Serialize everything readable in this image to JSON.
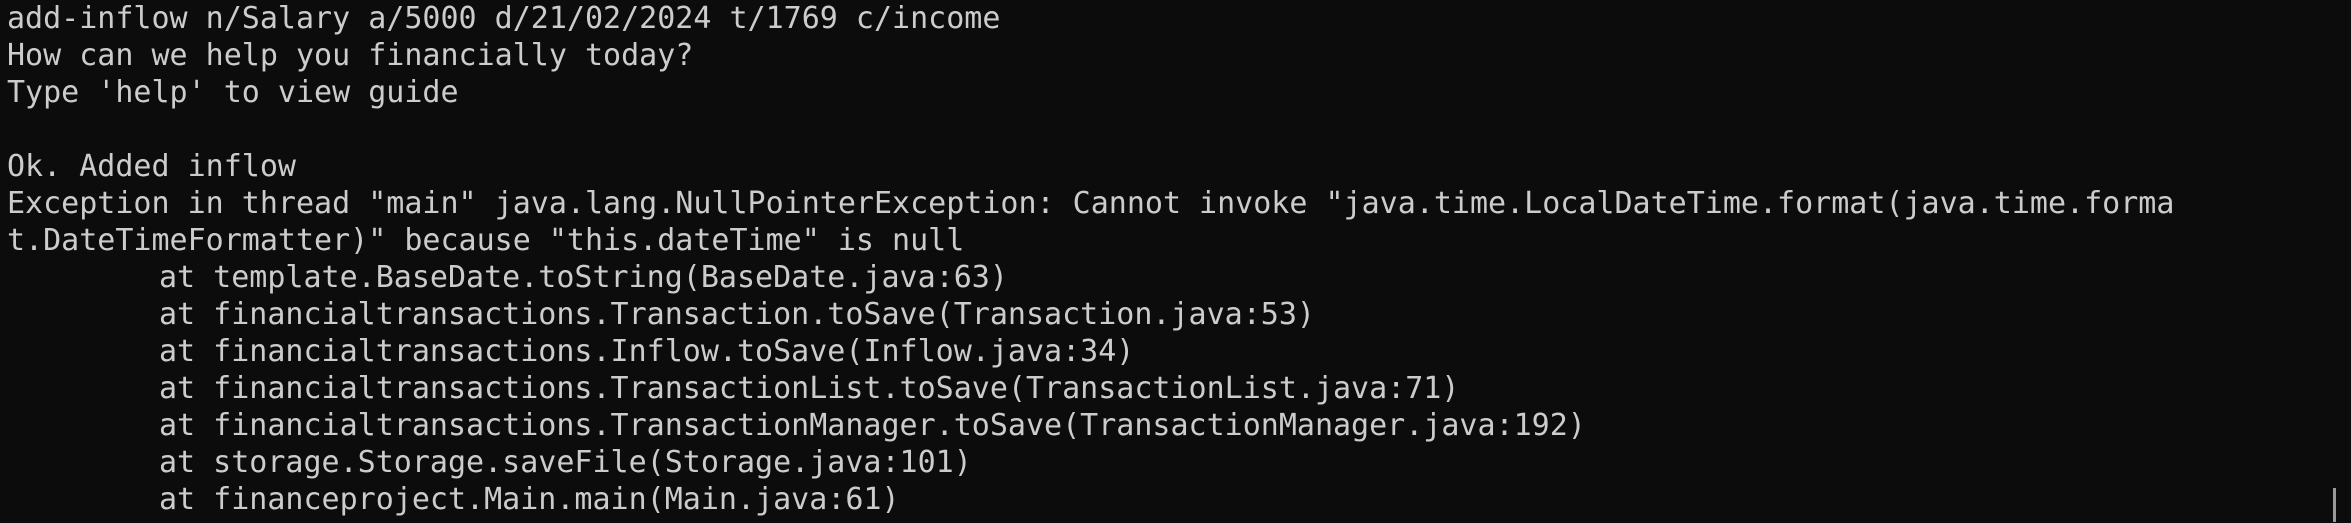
{
  "terminal": {
    "lines": [
      "add-inflow n/Salary a/5000 d/21/02/2024 t/1769 c/income",
      "How can we help you financially today?",
      "Type 'help' to view guide",
      "",
      "Ok. Added inflow",
      "Exception in thread \"main\" java.lang.NullPointerException: Cannot invoke \"java.time.LocalDateTime.format(java.time.forma",
      "t.DateTimeFormatter)\" because \"this.dateTime\" is null",
      "at template.BaseDate.toString(BaseDate.java:63)",
      "at financialtransactions.Transaction.toSave(Transaction.java:53)",
      "at financialtransactions.Inflow.toSave(Inflow.java:34)",
      "at financialtransactions.TransactionList.toSave(TransactionList.java:71)",
      "at financialtransactions.TransactionManager.toSave(TransactionManager.java:192)",
      "at storage.Storage.saveFile(Storage.java:101)",
      "at financeproject.Main.main(Main.java:61)"
    ]
  },
  "colors": {
    "background": "#0c0c0c",
    "foreground": "#cccccc",
    "scrollbar_thumb": "#9a9a9a"
  }
}
